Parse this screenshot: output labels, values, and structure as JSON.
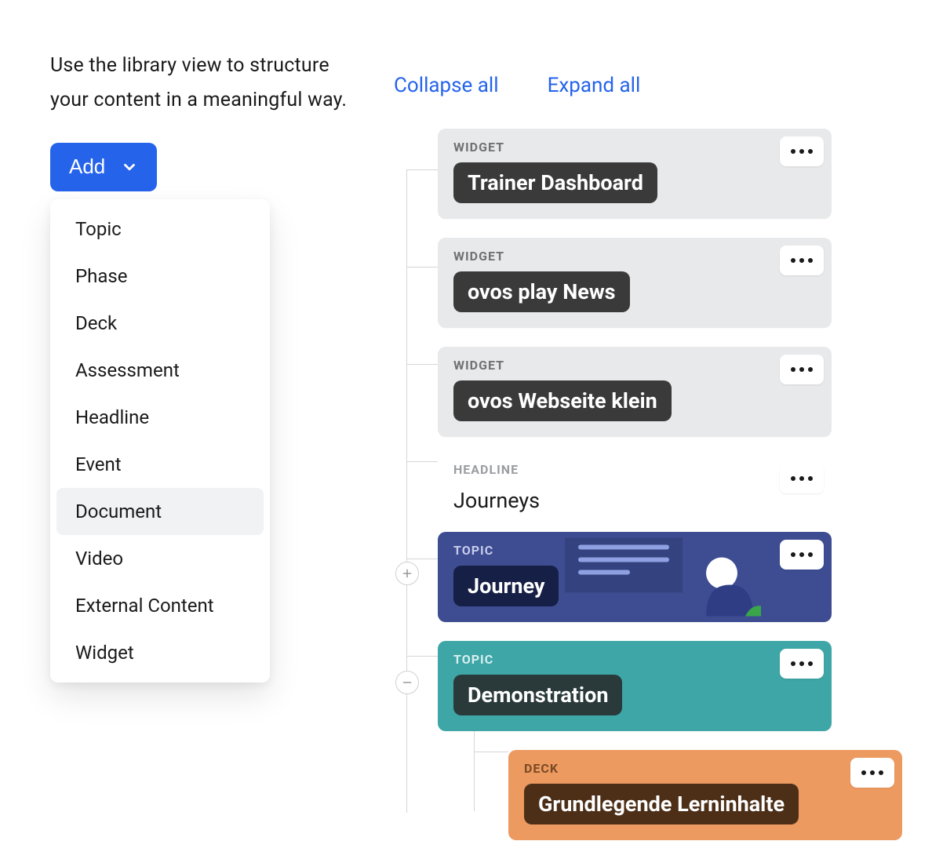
{
  "intro": "Use the library view to structure your content in a meaningful way.",
  "add": {
    "label": "Add",
    "items": [
      "Topic",
      "Phase",
      "Deck",
      "Assessment",
      "Headline",
      "Event",
      "Document",
      "Video",
      "External Content",
      "Widget"
    ],
    "hover_index": 6
  },
  "links": {
    "collapse_all": "Collapse all",
    "expand_all": "Expand all"
  },
  "nodes": [
    {
      "kind": "widget",
      "type_label": "WIDGET",
      "title": "Trainer Dashboard"
    },
    {
      "kind": "widget",
      "type_label": "WIDGET",
      "title": "ovos play News"
    },
    {
      "kind": "widget",
      "type_label": "WIDGET",
      "title": "ovos Webseite klein"
    },
    {
      "kind": "headline",
      "type_label": "HEADLINE",
      "title": "Journeys"
    },
    {
      "kind": "topic",
      "type_label": "TOPIC",
      "title": "Journey",
      "variant": "journey",
      "toggle": "plus"
    },
    {
      "kind": "topic",
      "type_label": "TOPIC",
      "title": "Demonstration",
      "variant": "demo",
      "toggle": "minus"
    },
    {
      "kind": "deck",
      "type_label": "DECK",
      "title": "Grundlegende Lerninhalte"
    }
  ]
}
